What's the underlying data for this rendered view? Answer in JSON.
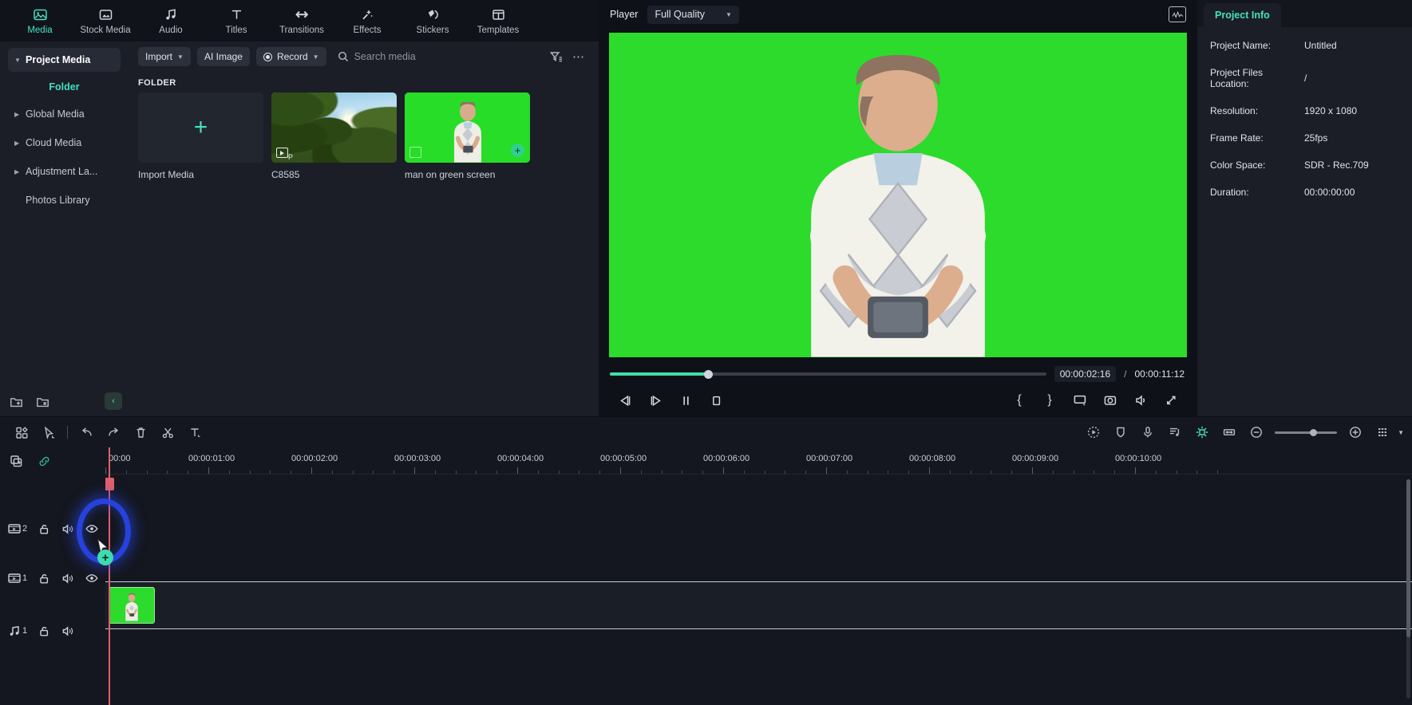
{
  "nav_tabs": [
    {
      "label": "Media",
      "icon": "media-icon",
      "active": true
    },
    {
      "label": "Stock Media",
      "icon": "stock-media-icon",
      "active": false
    },
    {
      "label": "Audio",
      "icon": "audio-icon",
      "active": false
    },
    {
      "label": "Titles",
      "icon": "titles-icon",
      "active": false
    },
    {
      "label": "Transitions",
      "icon": "transitions-icon",
      "active": false
    },
    {
      "label": "Effects",
      "icon": "effects-icon",
      "active": false
    },
    {
      "label": "Stickers",
      "icon": "stickers-icon",
      "active": false
    },
    {
      "label": "Templates",
      "icon": "templates-icon",
      "active": false
    }
  ],
  "sidebar": {
    "items": [
      {
        "label": "Project Media",
        "selected": true,
        "caret": true
      },
      {
        "label": "Folder",
        "is_header": true
      },
      {
        "label": "Global Media",
        "selected": false,
        "caret": true
      },
      {
        "label": "Cloud Media",
        "selected": false,
        "caret": true
      },
      {
        "label": "Adjustment La...",
        "selected": false,
        "caret": true
      },
      {
        "label": "Photos Library",
        "selected": false,
        "caret": false
      }
    ],
    "bottom_icons": [
      "new-folder-icon",
      "delete-folder-icon"
    ],
    "collapse_label": "‹"
  },
  "media_toolbar": {
    "import_label": "Import",
    "ai_image_label": "AI Image",
    "record_label": "Record",
    "search_placeholder": "Search media",
    "search_value": "",
    "filter_icon": "filter-icon",
    "more_icon": "more-options-icon"
  },
  "media_panel": {
    "folder_label": "FOLDER",
    "items": [
      {
        "label": "Import Media",
        "type": "add"
      },
      {
        "label": "C8585",
        "type": "video"
      },
      {
        "label": "man on green screen",
        "type": "image",
        "selected": true
      }
    ]
  },
  "player": {
    "title": "Player",
    "quality": "Full Quality",
    "scope_icon": "waveform-scope-icon",
    "current_time": "00:00:02:16",
    "separator": "/",
    "total_time": "00:00:11:12",
    "progress_percent": 22.5,
    "controls": [
      {
        "name": "prev-frame-button",
        "icon": "prev-frame-icon"
      },
      {
        "name": "next-frame-button",
        "icon": "next-frame-icon"
      },
      {
        "name": "pause-button",
        "icon": "pause-icon"
      },
      {
        "name": "stop-button",
        "icon": "stop-icon"
      }
    ],
    "right_controls": [
      {
        "name": "mark-in-button",
        "label": "{"
      },
      {
        "name": "mark-out-button",
        "label": "}"
      },
      {
        "name": "display-settings-button",
        "icon": "monitor-icon"
      },
      {
        "name": "snapshot-button",
        "icon": "camera-icon"
      },
      {
        "name": "volume-button",
        "icon": "volume-icon"
      },
      {
        "name": "fullscreen-button",
        "icon": "expand-icon"
      }
    ]
  },
  "project_info": {
    "tab_label": "Project Info",
    "rows": [
      {
        "key": "Project Name:",
        "value": "Untitled"
      },
      {
        "key": "Project Files Location:",
        "value": "/"
      },
      {
        "key": "Resolution:",
        "value": "1920 x 1080"
      },
      {
        "key": "Frame Rate:",
        "value": "25fps"
      },
      {
        "key": "Color Space:",
        "value": "SDR - Rec.709"
      },
      {
        "key": "Duration:",
        "value": "00:00:00:00"
      }
    ]
  },
  "timeline_toolbar": {
    "left_tools": [
      {
        "name": "layout-button",
        "icon": "grid-icon"
      },
      {
        "name": "select-tool-button",
        "icon": "cursor-icon"
      },
      {
        "name": "undo-button",
        "icon": "undo-icon"
      },
      {
        "name": "redo-button",
        "icon": "redo-icon"
      },
      {
        "name": "delete-button",
        "icon": "trash-icon"
      },
      {
        "name": "split-button",
        "icon": "scissors-icon"
      },
      {
        "name": "text-tool-button",
        "icon": "text-icon"
      }
    ],
    "center_tools": [
      {
        "name": "auto-reframe-button",
        "icon": "auto-reframe-icon"
      },
      {
        "name": "mask-button",
        "icon": "shield-icon"
      },
      {
        "name": "voiceover-button",
        "icon": "microphone-icon"
      },
      {
        "name": "audio-mixer-button",
        "icon": "audio-mixer-icon"
      },
      {
        "name": "green-screen-button",
        "icon": "green-screen-icon"
      },
      {
        "name": "fit-to-timeline-button",
        "icon": "fit-width-icon"
      }
    ],
    "zoom_out_icon": "zoom-out-icon",
    "zoom_in_icon": "zoom-in-icon",
    "zoom_level_percent": 62,
    "view_options_icon": "list-view-icon"
  },
  "timeline": {
    "header_icons": [
      {
        "name": "add-track-button",
        "icon": "add-track-icon"
      },
      {
        "name": "link-button",
        "icon": "link-icon"
      }
    ],
    "ruler_labels": [
      "00:00",
      "00:00:01:00",
      "00:00:02:00",
      "00:00:03:00",
      "00:00:04:00",
      "00:00:05:00",
      "00:00:06:00",
      "00:00:07:00",
      "00:00:08:00",
      "00:00:09:00",
      "00:00:10:00"
    ],
    "tracks": [
      {
        "name": "video-track-2",
        "type": "video",
        "number": "2",
        "lock": "unlocked",
        "mute": "on",
        "eye": "visible"
      },
      {
        "name": "video-track-1",
        "type": "video",
        "number": "1",
        "lock": "unlocked",
        "mute": "on",
        "eye": "visible"
      },
      {
        "name": "audio-track-1",
        "type": "audio",
        "number": "1",
        "lock": "unlocked",
        "mute": "on"
      }
    ],
    "clip": {
      "name": "man-on-green-screen-clip",
      "track": "video-track-1"
    },
    "playhead_time": "00:00:00:00",
    "drop_badge_label": "+"
  },
  "colors": {
    "accent": "#45e0c0",
    "highlight": "#2846eb",
    "playhead": "#e0606b",
    "green_screen": "#2cdb2c"
  }
}
